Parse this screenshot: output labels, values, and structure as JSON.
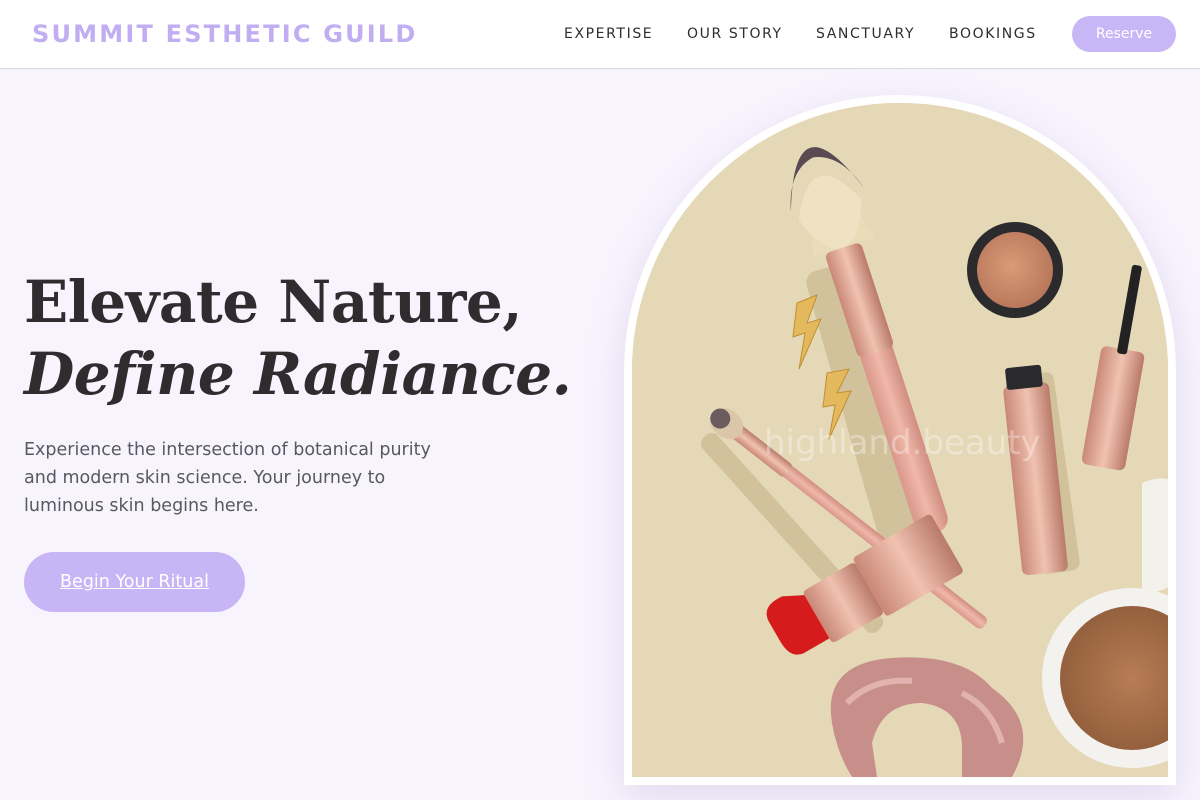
{
  "header": {
    "brand": "SUMMIT ESTHETIC GUILD",
    "nav": [
      "EXPERTISE",
      "OUR STORY",
      "SANCTUARY",
      "BOOKINGS"
    ],
    "reserve_label": "Reserve"
  },
  "hero": {
    "title_line1": "Elevate Nature,",
    "title_line2": "Define Radiance.",
    "lead": "Experience the intersection of botanical purity and modern skin science. Your journey to luminous skin begins here.",
    "cta_label": "Begin Your Ritual",
    "image_watermark": "highland.beauty"
  },
  "colors": {
    "accent": "#c9b6f6",
    "brand": "#c1adf1",
    "background": "#f8f4fe",
    "text_dark": "#2e2c2f",
    "text_muted": "#585860",
    "photo_backdrop": "#e5d8b7"
  },
  "icons": []
}
